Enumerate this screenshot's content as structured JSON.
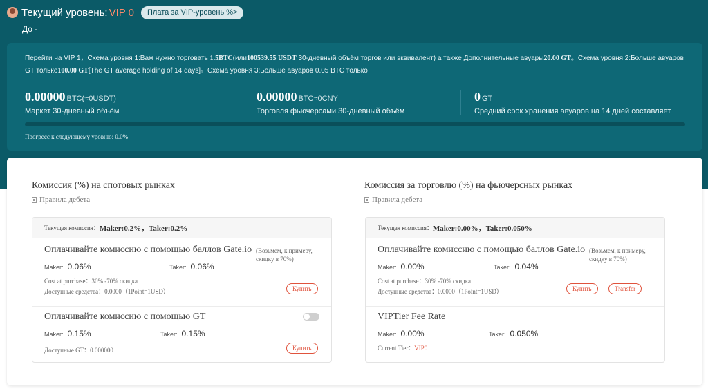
{
  "header": {
    "level_label": "Текущий уровень:",
    "level_value": "VIP 0",
    "vip_fee_button": "Плата за VIP-уровень %>",
    "until_label": "До -"
  },
  "vip_panel": {
    "description": {
      "p1": "Перейти на VIP 1，Схема уровня 1:Вам нужно торговать ",
      "b1": "1.5BTC",
      "p2": "(или",
      "b2": "100539.55 USDT",
      "p3": " 30-дневный объём торгов или эквивалент) а также Дополнительные авуары",
      "b3": "20.00 GT",
      "p4": "。Схема уровня 2:Больше авуаров GT только",
      "b4": "100.00 GT",
      "p5": "[The GT average holding of 14 days]。Схема уровня 3:Больше авуаров 0.05 BTC только"
    },
    "stats": [
      {
        "value": "0.00000",
        "unit": "BTC(≈0USDT)",
        "label": "Маркет 30-дневный объём"
      },
      {
        "value": "0.00000",
        "unit": "BTC≈0CNY",
        "label": "Торговля фьючерсами 30-дневный объём"
      },
      {
        "value": "0",
        "unit": "GT",
        "label": "Средний срок хранения авуаров на 14 дней составляет"
      }
    ],
    "progress_value": 0.0,
    "progress_label": "Прогресс к следующему уровню: 0.0%"
  },
  "spot": {
    "title": "Комиссия (%) на спотовых рынках",
    "debit_rules": "Правила дебета",
    "current_label": "Текущая комиссия：",
    "current_value": "Maker:0.2%，Taker:0.2%",
    "points": {
      "title": "Оплачивайте комиссию с помощью баллов Gate.io",
      "note": "(Возьмем, к примеру, скидку в 70%)",
      "maker_label": "Maker:",
      "maker_value": "0.06%",
      "taker_label": "Taker:",
      "taker_value": "0.06%",
      "cost": "Cost at purchase：30% -70% скидка",
      "available": "Доступные средства：0.0000（1Point=1USD）",
      "buy": "Купить"
    },
    "gt": {
      "title": "Оплачивайте комиссию с помощью GT",
      "maker_label": "Maker:",
      "maker_value": "0.15%",
      "taker_label": "Taker:",
      "taker_value": "0.15%",
      "available": "Доступные GT：0.000000",
      "buy": "Купить"
    }
  },
  "futures": {
    "title": "Комиссия за торговлю (%) на фьючерсных рынках",
    "debit_rules": "Правила дебета",
    "current_label": "Текущая комиссия：",
    "current_value": "Maker:0.00%，Taker:0.050%",
    "points": {
      "title": "Оплачивайте комиссию с помощью баллов Gate.io",
      "note": "(Возьмем, к примеру, скидку в 70%)",
      "maker_label": "Maker:",
      "maker_value": "0.00%",
      "taker_label": "Taker:",
      "taker_value": "0.04%",
      "cost": "Cost at purchase：30% -70% скидка",
      "available": "Доступные средства：0.0000（1Point=1USD）",
      "buy": "Купить",
      "transfer": "Transfer"
    },
    "vip_tier": {
      "title": "VIPTier Fee Rate",
      "maker_label": "Maker:",
      "maker_value": "0.00%",
      "taker_label": "Taker:",
      "taker_value": "0.050%",
      "tier_label": "Current Tier：",
      "tier_value": "VIP0"
    }
  },
  "colors": {
    "band": "#0b5a67",
    "panel": "#0e6876",
    "accent": "#ff8a6a",
    "button_red": "#e0533d"
  }
}
